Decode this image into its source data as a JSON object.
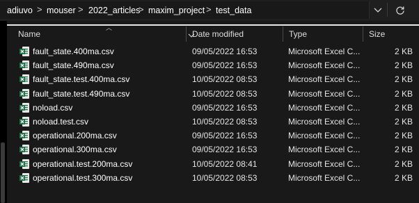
{
  "breadcrumb": [
    "adiuvo",
    "mouser",
    "2022_articles",
    "maxim_project",
    "test_data"
  ],
  "breadcrumb_separator": ">",
  "columns": {
    "name": "Name",
    "date_modified": "Date modified",
    "type": "Type",
    "size": "Size"
  },
  "files": [
    {
      "name": "fault_state.400ma.csv",
      "date": "09/05/2022 16:53",
      "type": "Microsoft Excel C...",
      "size": "2 KB"
    },
    {
      "name": "fault_state.490ma.csv",
      "date": "09/05/2022 16:53",
      "type": "Microsoft Excel C...",
      "size": "2 KB"
    },
    {
      "name": "fault_state.test.400ma.csv",
      "date": "10/05/2022 08:53",
      "type": "Microsoft Excel C...",
      "size": "2 KB"
    },
    {
      "name": "fault_state.test.490ma.csv",
      "date": "10/05/2022 08:53",
      "type": "Microsoft Excel C...",
      "size": "2 KB"
    },
    {
      "name": "noload.csv",
      "date": "09/05/2022 16:53",
      "type": "Microsoft Excel C...",
      "size": "2 KB"
    },
    {
      "name": "noload.test.csv",
      "date": "10/05/2022 08:53",
      "type": "Microsoft Excel C...",
      "size": "2 KB"
    },
    {
      "name": "operational.200ma.csv",
      "date": "09/05/2022 16:53",
      "type": "Microsoft Excel C...",
      "size": "2 KB"
    },
    {
      "name": "operational.300ma.csv",
      "date": "09/05/2022 16:53",
      "type": "Microsoft Excel C...",
      "size": "2 KB"
    },
    {
      "name": "operational.test.200ma.csv",
      "date": "10/05/2022 08:41",
      "type": "Microsoft Excel C...",
      "size": "2 KB"
    },
    {
      "name": "operational.test.300ma.csv",
      "date": "10/05/2022 08:53",
      "type": "Microsoft Excel C...",
      "size": "2 KB"
    }
  ],
  "icons": {
    "file_icon": "excel-csv-icon",
    "history_button": "chevron-down-icon",
    "refresh_button": "refresh-icon"
  },
  "colors": {
    "background": "#191919",
    "excel_green": "#1d7044",
    "text": "#ffffff"
  }
}
